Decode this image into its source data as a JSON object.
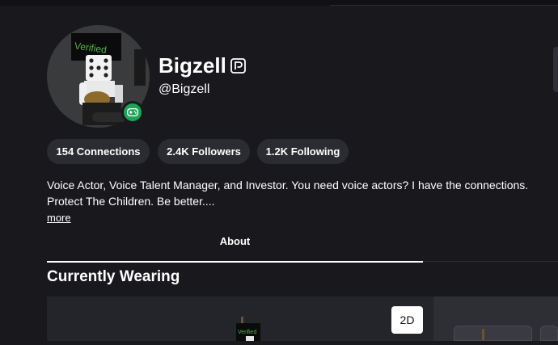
{
  "profile": {
    "display_name": "Bigzell",
    "username": "@Bigzell",
    "avatar_sign_text": "Verified",
    "presence": "in-game",
    "presence_color": "#1fa358"
  },
  "stats": {
    "connections": "154 Connections",
    "followers": "2.4K Followers",
    "following": "1.2K Following"
  },
  "bio": {
    "text": "Voice Actor, Voice Talent Manager, and Investor. You need voice actors? I have the connections. Protect The Children. Be better....",
    "more_label": "more"
  },
  "tabs": {
    "about_label": "About"
  },
  "wearing": {
    "title": "Currently Wearing",
    "toggle_label": "2D"
  },
  "icons": {
    "premium": "premium-icon",
    "presence": "gamepad-icon"
  },
  "colors": {
    "background": "#19191d",
    "pill": "#2b2c32",
    "presence_green": "#1fa358"
  }
}
